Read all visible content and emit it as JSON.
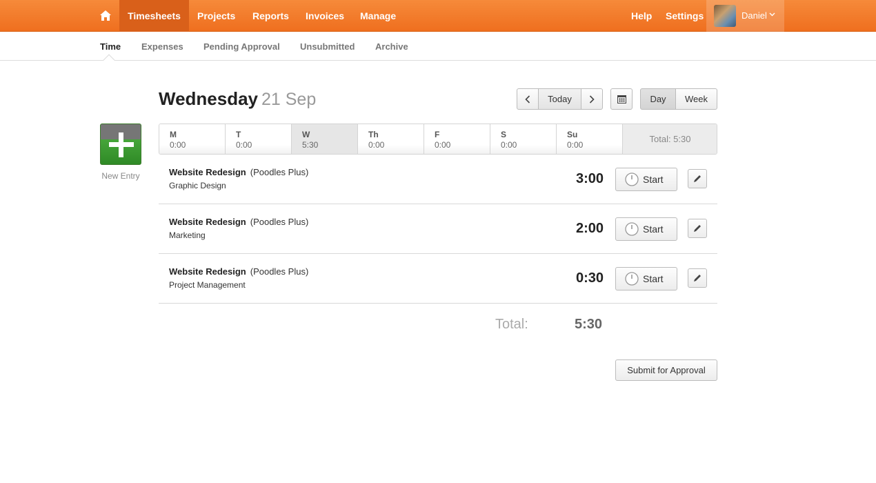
{
  "topnav": {
    "items": [
      "Timesheets",
      "Projects",
      "Reports",
      "Invoices",
      "Manage"
    ],
    "active": "Timesheets",
    "help": "Help",
    "settings": "Settings",
    "user": "Daniel",
    "brand_color": "#f0741f"
  },
  "subnav": {
    "tabs": [
      "Time",
      "Expenses",
      "Pending Approval",
      "Unsubmitted",
      "Archive"
    ],
    "active": "Time"
  },
  "header": {
    "weekday": "Wednesday",
    "date": "21 Sep",
    "prev_icon": "chevron-left-icon",
    "today": "Today",
    "next_icon": "chevron-right-icon",
    "calendar_icon": "calendar-icon",
    "view_day": "Day",
    "view_week": "Week",
    "active_view": "Day"
  },
  "new_entry": {
    "label": "New Entry",
    "icon": "plus-icon"
  },
  "week": {
    "days": [
      {
        "label": "M",
        "hours": "0:00"
      },
      {
        "label": "T",
        "hours": "0:00"
      },
      {
        "label": "W",
        "hours": "5:30"
      },
      {
        "label": "Th",
        "hours": "0:00"
      },
      {
        "label": "F",
        "hours": "0:00"
      },
      {
        "label": "S",
        "hours": "0:00"
      },
      {
        "label": "Su",
        "hours": "0:00"
      }
    ],
    "active_day": "W",
    "total": "Total: 5:30"
  },
  "entries": [
    {
      "project": "Website Redesign",
      "client": "(Poodles Plus)",
      "task": "Graphic Design",
      "duration": "3:00",
      "start_label": "Start"
    },
    {
      "project": "Website Redesign",
      "client": "(Poodles Plus)",
      "task": "Marketing",
      "duration": "2:00",
      "start_label": "Start"
    },
    {
      "project": "Website Redesign",
      "client": "(Poodles Plus)",
      "task": "Project Management",
      "duration": "0:30",
      "start_label": "Start"
    }
  ],
  "footer": {
    "total_label": "Total:",
    "total_value": "5:30",
    "submit": "Submit for Approval"
  }
}
